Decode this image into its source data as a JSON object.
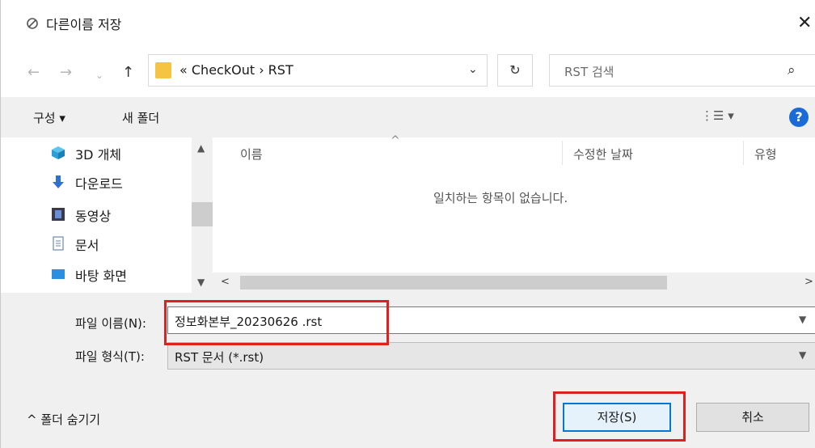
{
  "window": {
    "title": "다른이름 저장",
    "close_glyph": "✕"
  },
  "nav": {
    "back_glyph": "←",
    "forward_glyph": "→",
    "recent_glyph": "⌄",
    "up_glyph": "↑",
    "address": "« CheckOut › RST",
    "address_dropdown_glyph": "⌄",
    "refresh_glyph": "↻",
    "search_placeholder": "RST 검색",
    "search_glyph": "⌕"
  },
  "toolbar": {
    "organize_label": "구성 ▾",
    "new_folder_label": "새 폴더",
    "view_glyph": "⋮☰ ▾",
    "help_glyph": "?"
  },
  "sidebar": {
    "items": [
      {
        "label": "3D 개체",
        "icon": "cube-icon"
      },
      {
        "label": "다운로드",
        "icon": "download-arrow-icon"
      },
      {
        "label": "동영상",
        "icon": "film-icon"
      },
      {
        "label": "문서",
        "icon": "document-icon"
      },
      {
        "label": "바탕 화면",
        "icon": "desktop-icon"
      }
    ]
  },
  "filelist": {
    "columns": [
      "이름",
      "수정한 날짜",
      "유형"
    ],
    "empty_message": "일치하는 항목이 없습니다."
  },
  "form": {
    "filename_label": "파일 이름(N):",
    "filename_value": "정보화본부_20230626 .rst",
    "filetype_label": "파일 형식(T):",
    "filetype_value": "RST 문서 (*.rst)"
  },
  "footer": {
    "hide_folders_label": "^ 폴더 숨기기",
    "save_label": "저장(S)",
    "cancel_label": "취소"
  },
  "colors": {
    "highlight": "#e02020",
    "accent": "#0078d7",
    "folder": "#f5c443"
  }
}
